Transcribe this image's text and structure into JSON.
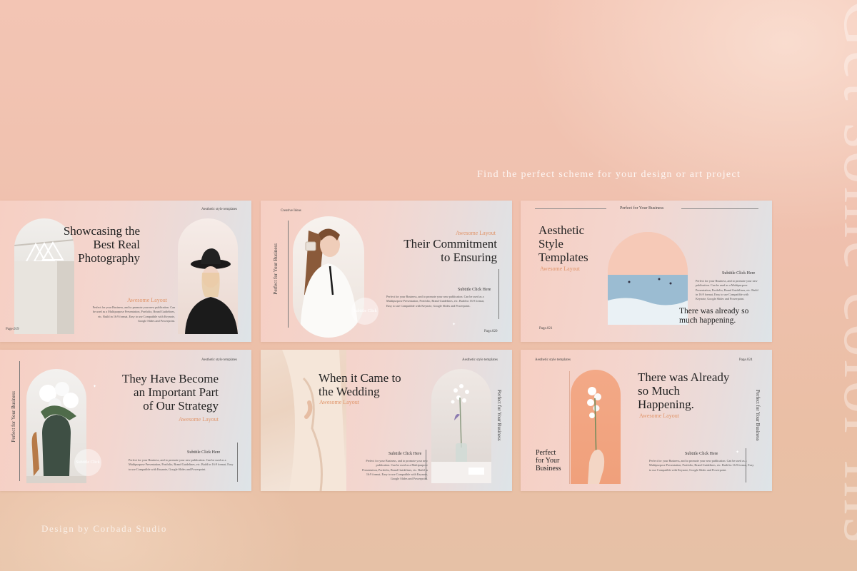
{
  "tagline": "Find the perfect scheme for your design or art project",
  "vertical_heading": "Get some color ins",
  "credit": "Design by Corbada Studio",
  "colors": {
    "background": "#efc2ae",
    "accent": "#e0956a",
    "ink": "#222222"
  },
  "slides": [
    {
      "header": "Aesthetic style templates",
      "title_lines": [
        "Showcasing the",
        "Best Real",
        "Photography"
      ],
      "accent": "Awesome Layout",
      "body": "Perfect for your Business, and to promote your new publication. Can be used as a Multipurpose Presentation, Portfolio, Brand Guidelines, etc. Build in 16:9 format, Easy to use Compatible with Keynote, Google Slides and Powerpoint.",
      "page": "Page.019",
      "photo": "woman-black-hat-photo",
      "photo2": "clothes-hangers-photo"
    },
    {
      "header": "Creative Ideas",
      "vertical": "Perfect for Your Business",
      "accent": "Awesome Layout",
      "title_lines": [
        "Their Commitment",
        "to Ensuring"
      ],
      "sub": "Subtitle Click Here",
      "body": "Perfect for your Business, and to promote your new publication. Can be used as a Multipurpose Presentation, Portfolio, Brand Guidelines, etc. Build in 16:9 format, Easy to use Compatible with Keynote, Google Slides and Powerpoint.",
      "badge": "Subtitle Click",
      "page": "Page.020",
      "photo": "woman-white-shirt-photo"
    },
    {
      "header": "Perfect for Your Business",
      "title_lines": [
        "Aesthetic",
        "Style",
        "Templates"
      ],
      "accent": "Awesome Layout",
      "sub": "Subtitle Click Here",
      "body": "Perfect for your Business, and to promote your new publication. Can be used as a Multipurpose Presentation, Portfolio, Brand Guidelines, etc. Build in 16:9 format, Easy to use Compatible with Keynote, Google Slides and Powerpoint.",
      "quote_lines": [
        "There was already so",
        "much happening."
      ],
      "page": "Page.021",
      "photo": "ocean-surfers-photo"
    },
    {
      "header": "Aesthetic style templates",
      "vertical": "Perfect for Your Business",
      "title_lines": [
        "They Have Become",
        "an Important Part",
        "of Our Strategy"
      ],
      "accent": "Awesome Layout",
      "sub": "Subtitle Click Here",
      "body": "Perfect for your Business, and to promote your new publication. Can be used as a Multipurpose Presentation, Portfolio, Brand Guidelines, etc. Build in 16:9 format, Easy to use Compatible with Keynote, Google Slides and Powerpoint.",
      "badge": "Subtitle Click",
      "photo": "white-flowers-vase-photo"
    },
    {
      "header": "Aesthetic style templates",
      "vertical": "Perfect for Your Business",
      "title_lines": [
        "When it Came to",
        "the Wedding"
      ],
      "accent": "Awesome Layout",
      "sub": "Subtitle Click Here",
      "body": "Perfect for your Business, and to promote your new publication. Can be used as a Multipurpose Presentation, Portfolio, Brand Guidelines, etc. Build in 16:9 format, Easy to use Compatible with Keynote, Google Slides and Powerpoint.",
      "photo": "wedding-dress-photo",
      "photo2": "table-flowers-photo"
    },
    {
      "header": "Aesthetic style templates",
      "page": "Page.024",
      "vertical": "Perfect for Your Business",
      "title_lines": [
        "There was Already",
        "so Much",
        "Happening."
      ],
      "accent": "Awesome Layout",
      "sub": "Subtitle Click Here",
      "body": "Perfect for your Business, and to promote your new publication. Can be used as a Multipurpose Presentation, Portfolio, Brand Guidelines, etc. Build in 16:9 format, Easy to use Compatible with Keynote, Google Slides and Powerpoint.",
      "side_lines": [
        "Perfect",
        "for Your",
        "Business"
      ],
      "photo": "hand-flower-photo"
    }
  ]
}
